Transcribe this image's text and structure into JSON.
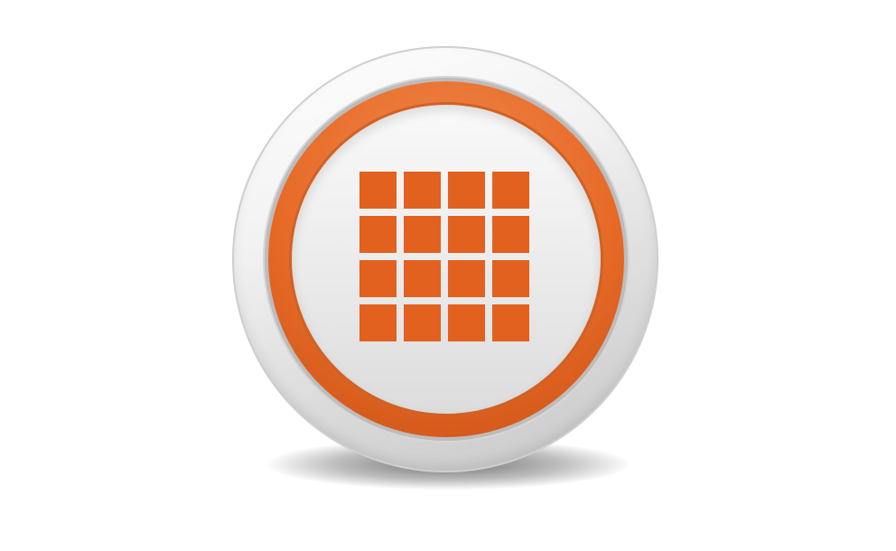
{
  "icon": {
    "semantic": "grid-icon",
    "rows": 4,
    "cols": 4
  },
  "colors": {
    "accent": "#e2611e",
    "ring_orange": "#e76a27",
    "face": "#ececec",
    "bezel": "#d9d9d9"
  }
}
